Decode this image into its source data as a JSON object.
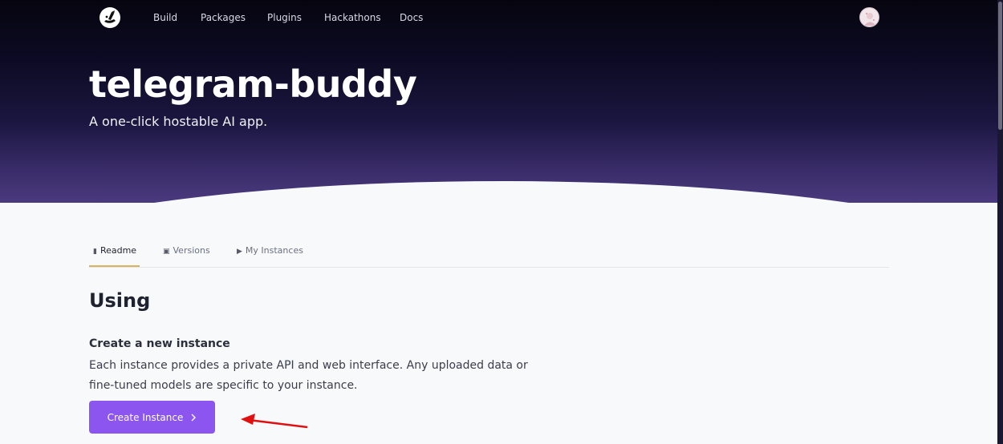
{
  "nav": {
    "logo_icon": "rocket-logo-icon",
    "links": [
      "Build",
      "Packages",
      "Plugins",
      "Hackathons",
      "Docs"
    ],
    "avatar_icon": "user-avatar-icon"
  },
  "hero": {
    "title": "telegram-buddy",
    "subtitle": "A one-click hostable AI app."
  },
  "tabs": [
    {
      "label": "Readme",
      "icon": "document-icon",
      "active": true
    },
    {
      "label": "Versions",
      "icon": "box-icon",
      "active": false
    },
    {
      "label": "My Instances",
      "icon": "play-icon",
      "active": false
    }
  ],
  "content": {
    "heading": "Using",
    "subheading": "Create a new instance",
    "paragraph": "Each instance provides a private API and web interface. Any uploaded data or fine-tuned models are specific to your instance.",
    "button_label": "Create Instance",
    "button_icon": "chevron-right-icon"
  },
  "colors": {
    "accent": "#8c55f0",
    "tab_underline": "#d8b45c",
    "annotation_arrow": "#e01010"
  }
}
